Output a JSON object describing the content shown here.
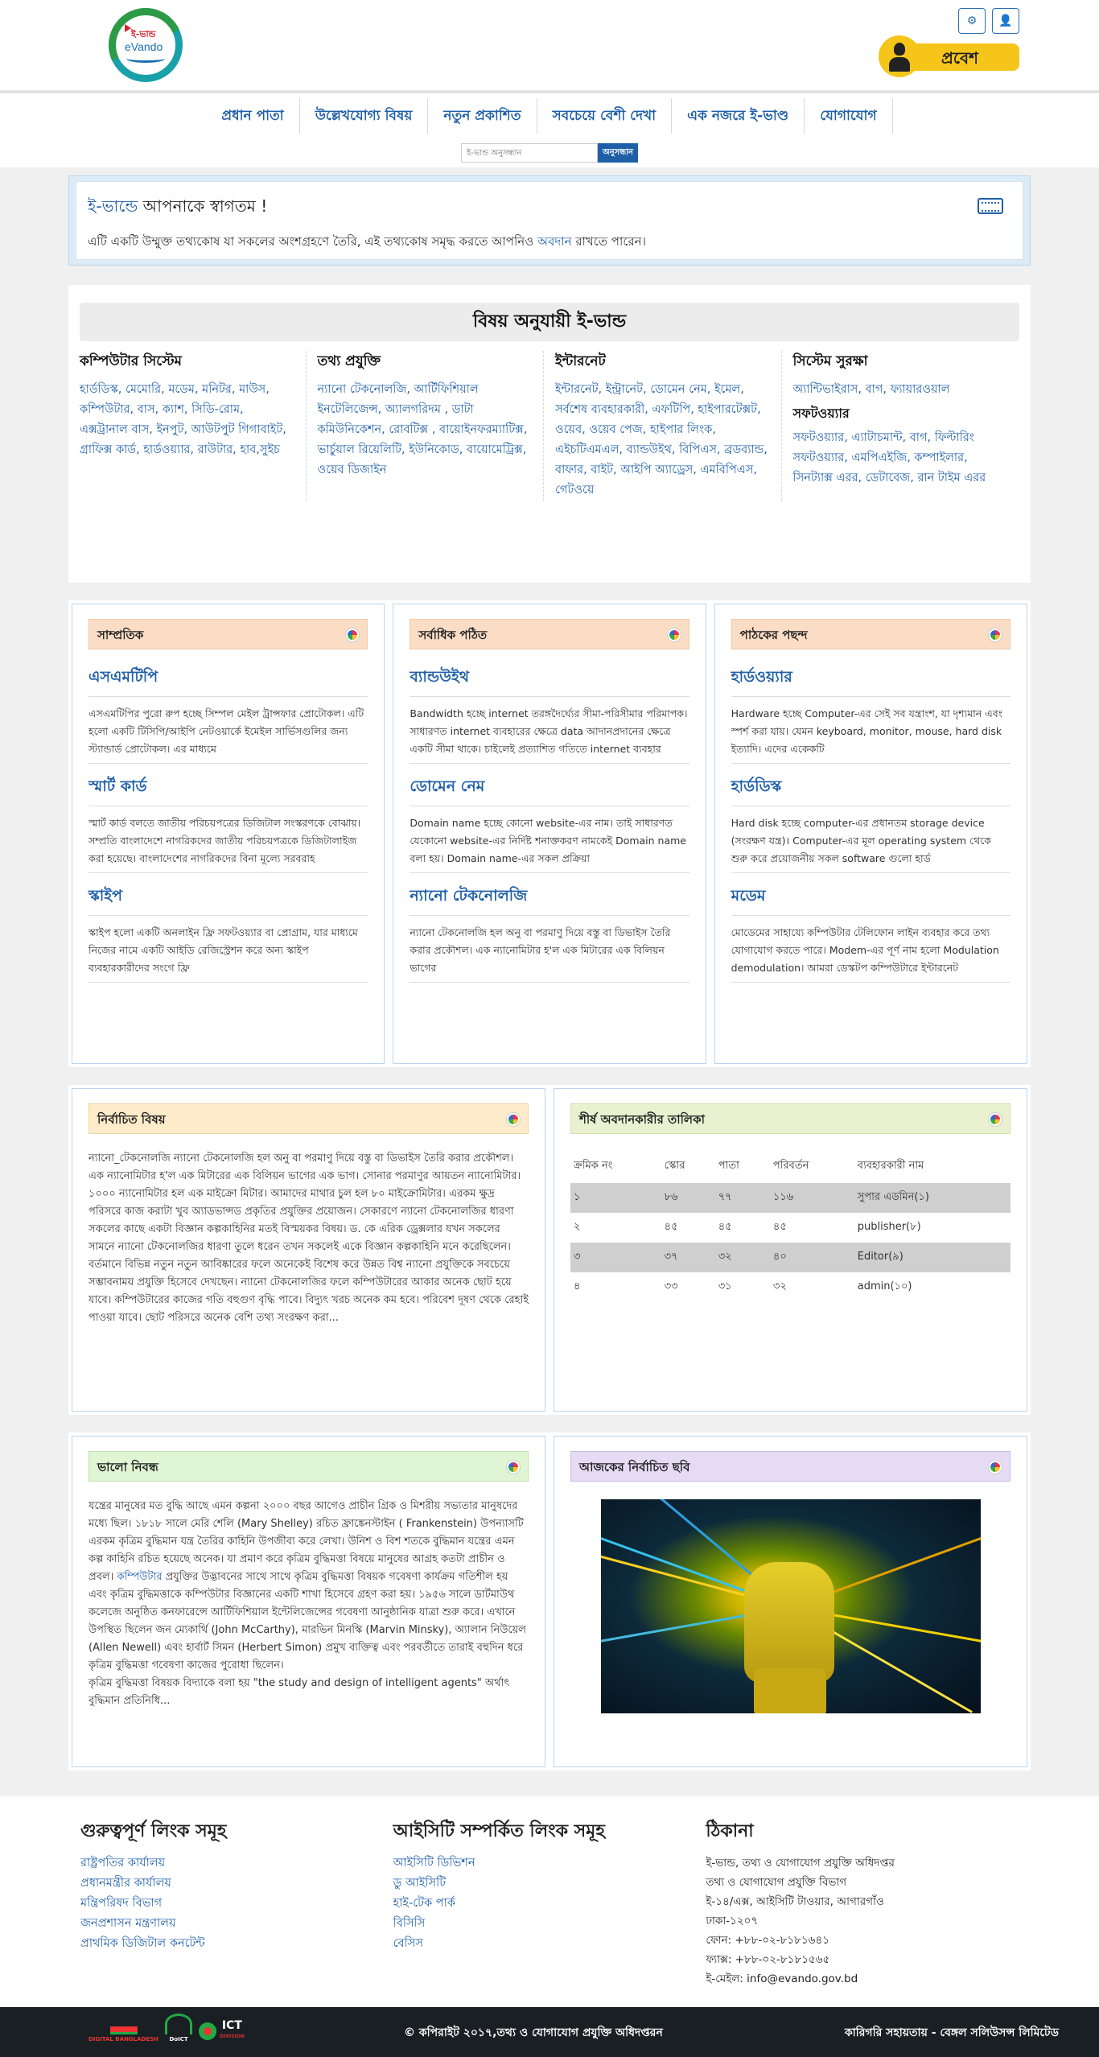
{
  "header": {
    "logo_text_top": "ই-ভান্ড",
    "logo_text": "eVando",
    "login_label": "প্রবেশ"
  },
  "nav": {
    "items": [
      "প্রধান পাতা",
      "উল্লেখযোগ্য বিষয়",
      "নতুন প্রকাশিত",
      "সবচেয়ে বেশী দেখা",
      "এক নজরে ই-ভাণ্ড",
      "যোগাযোগ"
    ],
    "search_placeholder": "ই-ভান্ড অনুসন্ধান",
    "search_button": "অনুসন্ধান"
  },
  "welcome": {
    "title_highlight": "ই-ভান্ডে",
    "title_rest": " আপনাকে স্বাগতম !",
    "text_before": "এটি একটি উম্মুক্ত তথ্যকোষ যা সকলের অংশগ্রহণে তৈরি, এই তথ্যকোষ সমৃদ্ধ করতে আপনিও ",
    "text_link": "অবদান",
    "text_after": " রাখতে পারেন।"
  },
  "subjects": {
    "title": "বিষয় অনুযায়ী ই-ভান্ড",
    "columns": [
      {
        "heading": "কম্পিউটার সিস্টেম",
        "links": "হার্ডডিস্ক, মেমোরি, মডেম, মনিটর, মাউস, কম্পিউটার, বাস, ক্যাশ, সিডি-রোম, এক্সট্রানাল বাস, ইনপুট, আউটপুট গিগাবাইট, গ্রাফিক্স কার্ড, হার্ডওয়্যার, রাউটার, হাব,সুইচ",
        "heading2": "",
        "links2": ""
      },
      {
        "heading": "তথ্য প্রযুক্তি",
        "links": "ন্যানো টেকনোলজি, আর্টিফিশিয়াল ইনটেলিজেন্স, অ্যালগরিদম , ডাটা কমিউনিকেশন, রোবটিক্স , বায়োইনফরম্যাটিক্স, ভার্চুয়াল রিয়েলিটি, ইউনিকোড, বায়োমেট্রিক্স, ওয়েব ডিজাইন",
        "heading2": "",
        "links2": ""
      },
      {
        "heading": "ইন্টারনেট",
        "links": "ইন্টারনেট, ইন্ট্রানেট, ডোমেন নেম, ইমেল, সর্বশেষ ব্যবহারকারী, এফটিপি, হাইপারটেক্সট, ওয়েব, ওয়েব পেজ, হাইপার লিংক, এইচটিএমএল, ব্যান্ডউইথ, বিপিএস, ব্রডব্যান্ড, বাফার, বাইট, আইপি অ্যাড্রেস, এমবিপিএস, গেটওয়ে",
        "heading2": "",
        "links2": ""
      },
      {
        "heading": "সিস্টেম সুরক্ষা",
        "links": "অ্যান্টিভাইরাস, বাগ, ফ্যায়ারওয়াল",
        "heading2": "সফটওয়্যার",
        "links2": "সফটওয়্যার, এ্যাটাচমান্ট, বাগ, ফিল্টারিং সফটওয়্যার, এমপিএইজি, কম্পাইলার, সিনট্যাক্স এরর, ডেটাবেজ, রান টাইম এরর"
      }
    ]
  },
  "panels_row1": [
    {
      "title": "সাম্প্রতিক",
      "articles": [
        {
          "title": "এসএমটিপি",
          "text": "এসএমটিপির পুরো রুপ হচ্ছে সিম্পল মেইল ট্রান্সফার প্রোটোকল। এটি হলো একটি টিসিপি/আইপি নেটওয়ার্কে ইমেইল সার্ভিসগুলির জন্য স্ট্যান্ডার্ড প্রোটোকল। এর মাধ্যমে"
        },
        {
          "title": "স্মার্ট কার্ড",
          "text": "স্মার্ট কার্ড বলতে জাতীয় পরিচয়পত্রের ডিজিটাল সংস্করণকে বোঝায়। সম্প্রতি বাংলাদেশে নাগরিকদের জাতীয় পরিচয়পত্রকে ডিজিটালাইজ করা হয়েছে। বাংলাদেশের নাগরিকদের বিনা মূল্যে সরবরাহ"
        },
        {
          "title": "স্কাইপ",
          "text": "স্কাইপ হলো একটি অনলাইন ফ্রি সফটওয়্যার বা প্রোগ্রাম, যার মাধ্যমে নিজের নামে একটি আইডি রেজিস্ট্রেশন করে অন্য স্কাইপ ব্যবহারকারীদের সংগে ফ্রি"
        }
      ]
    },
    {
      "title": "সর্বাধিক পঠিত",
      "articles": [
        {
          "title": "ব্যান্ডউইথ",
          "text": "Bandwidth হচ্ছে internet তরঙ্গদৈর্ঘ্যের সীমা-পরিসীমার পরিমাপক। সাধারণত internet ব্যবহারের ক্ষেত্রে data আদানপ্রদানের ক্ষেত্রে একটি সীমা থাকে। চাইলেই প্রত্যাশিত গতিতে internet ব্যবহার"
        },
        {
          "title": "ডোমেন নেম",
          "text": "Domain name হচ্ছে কোনো website-এর নাম। তাই সাধারণত যেকোনো website-এর নির্দিষ্ট শনাক্তকরণ নামকেই Domain name বলা হয়। Domain name-এর সকল প্রক্রিয়া"
        },
        {
          "title": "ন্যানো টেকনোলজি",
          "text": "ন্যানো টেকনোলজি হল অনু বা পরমাণু দিয়ে বস্তু বা ডিভাইস তৈরি করার প্রকৌশল। এক ন্যানোমিটার হ'ল এক মিটারের এক বিলিয়ন ভাগের"
        }
      ]
    },
    {
      "title": "পাঠকের পছন্দ",
      "articles": [
        {
          "title": "হার্ডওয়্যার",
          "text": "Hardware হচ্ছে Computer-এর সেই সব যন্ত্রাংশ, যা দৃশ্যমান এবং স্পর্শ করা যায়। যেমন keyboard, monitor, mouse, hard disk ইত্যাদি। এদের একেকটি"
        },
        {
          "title": "হার্ডডিস্ক",
          "text": "Hard disk হচ্ছে computer-এর প্রধানতম storage device (সংরক্ষণ যন্ত্র)। Computer-এর মূল operating system থেকে শুরু করে প্রয়োজনীয় সকল software গুলো হার্ড"
        },
        {
          "title": "মডেম",
          "text": "মোডেমের সাহায্যে কম্পিউটার টেলিফোন লাইন ব্যবহার করে তথ্য যোগাযোগ করতে পারে। Modem-এর পূর্ণ নাম হলো Modulation demodulation। আমরা ডেস্কটপ কম্পিউটারে ইন্টারনেট"
        }
      ]
    }
  ],
  "featured": {
    "title": "নির্বাচিত বিষয়",
    "text": "ন্যানো_টেকনোলজি ন্যানো টেকনোলজি হল অনু বা পরমাণু দিয়ে বস্তু বা ডিভাইস তৈরি করার প্রকৌশল। এক ন্যানোমিটার হ'ল এক মিটারের এক বিলিয়ন ভাগের এক ভাগ। সোনার পরমাণুর আয়তন ন্যানোমিটার। ১০০০ ন্যানোমিটার হল এক মাইক্রো মিটার। আমাদের মাথার চুল হল ৮০ মাইক্রোমিটার। এরকম ক্ষুদ্র পরিসরে কাজ করাটা খুব অ্যাডভান্সড প্রকৃতির প্রযুক্তির প্রয়োজন। সেকারণে ন্যানো টেকনোলজির ধারণা সকলের কাছে একটা বিজ্ঞান কল্পকাহিনির মতই বিস্ময়কর বিষয়। ড. কে এরিক ড্রেক্সলার যখন সকলের সামনে ন্যানো টেকনোলজির ধারণা তুলে ধরেন তখন সকলেই একে বিজ্ঞান কল্পকাহিনি মনে করেছিলেন। বর্তমানে বিভিন্ন নতুন নতুন আবিষ্কারের ফলে অনেকেই বিশেষ করে উন্নত বিশ্ব ন্যানো প্রযুক্তিকে সবচেয়ে সম্ভাবনাময় প্রযুক্তি হিসেবে দেখছেন। ন্যানো টেকনোলজির ফলে কম্পিউটারের আকার অনেক ছোট হয়ে যাবে। কম্পিউটারের কাজের গতি বহুগুণ বৃদ্ধি পাবে। বিদ্যুৎ খরচ অনেক কম হবে। পরিবেশ দূষণ থেকে রেহাই পাওয়া যাবে। ছোট পরিসরে অনেক বেশি তথ্য সংরক্ষণ করা..."
  },
  "top_donors": {
    "title": "শীর্ষ অবদানকারীর তালিকা",
    "columns": [
      "ক্রমিক নং",
      "স্কোর",
      "পাতা",
      "পরিবর্তন",
      "ব্যবহারকারী নাম"
    ],
    "rows": [
      [
        "১",
        "৮৬",
        "৭৭",
        "১১৬",
        "সুপার এডমিন(১)"
      ],
      [
        "২",
        "৪৫",
        "৪৫",
        "৪৫",
        "publisher(৮)"
      ],
      [
        "৩",
        "৩৭",
        "৩২",
        "৪০",
        "Editor(৯)"
      ],
      [
        "৪",
        "৩৩",
        "৩১",
        "৩২",
        "admin(১০)"
      ]
    ]
  },
  "good_essay": {
    "title": "ভালো নিবন্ধ",
    "text_before": "যন্ত্রের মানুষের মত বুদ্ধি আছে এমন কল্পনা ২০০০ বছর আগেও প্রাচীন গ্রিক ও মিশরীয় সভ্যতার মানুষদের মধ্যে ছিল। ১৮১৮ সালে মেরি শেলি (Mary Shelley) রচিত ফ্রাঙ্কেনস্টাইন ( Frankenstein) উপন্যাসটি এরকম কৃত্রিম বুদ্ধিমান যন্ত্র তৈরির কাহিনি উপজীব্য করে লেখা। উনিশ ও বিশ শতকে বুদ্ধিমান যন্ত্রের এমন কল্প কাহিনি রচিত হয়েছে অনেক। যা প্রমাণ করে কৃত্রিম বুদ্ধিমত্তা বিষয়ে মানুষের আগ্রহ কতটা প্রাচীন ও প্রবল। ",
    "text_link": "কম্পিউটার",
    "text_after": " প্রযুক্তির উদ্ভাবনের সাথে সাথে কৃত্রিম বুদ্ধিমত্তা বিষয়ক গবেষণা কার্যক্রম গতিশীল হয় এবং কৃত্রিম বুদ্ধিমত্তাকে কম্পিউটার বিজ্ঞানের একটি শাখা হিসেবে গ্রহণ করা হয়। ১৯৫৬ সালে ডার্টমাউথ কলেজে অনুষ্ঠিত কনফারেন্সে আর্টিফিশিয়াল ইন্টেলিজেন্সের গবেষণা আনুষ্ঠানিক যাত্রা শুরু করে। এখানে উপস্থিত ছিলেন জন ম্যেকার্থি (John McCarthy), মারভিন মিনস্কি (Marvin Minsky), অ্যালান নিউয়েল (Allen Newell) এবং হার্বার্ট সিমন (Herbert Simon) প্রমুখ ব্যক্তিত্ব এবং পরবর্তীতে তারাই বহুদিন ধরে কৃত্রিম বুদ্ধিমত্তা গবেষণা কাজের পুরোধা ছিলেন।",
    "text2": "কৃত্রিম বুদ্ধিমত্তা বিষয়ক বিদ্যাকে বলা হয় \"the study and design of intelligent agents\" অর্থাৎ বুদ্ধিমান প্রতিনিধি..."
  },
  "picture_of_day": {
    "title": "আজকের নির্বাচিত ছবি"
  },
  "footer": {
    "col1": {
      "heading": "গুরুত্বপূর্ণ লিংক সমূহ",
      "links": [
        "রাষ্ট্রপতির কার্যালয়",
        "প্রধানমন্ত্রীর কার্যালয়",
        "মন্ত্রিপরিষদ বিভাগ",
        "জনপ্রশাসন মন্ত্রণালয়",
        "প্রাথমিক ডিজিটাল কনটেন্ট"
      ]
    },
    "col2": {
      "heading": "আইসিটি সম্পর্কিত লিংক সমূহ",
      "links": [
        "আইসিটি ডিভিশন",
        "ডু আইসিটি",
        "হাই-টেক পার্ক",
        "বিসিসি",
        "বেসিস"
      ]
    },
    "col3": {
      "heading": "ঠিকানা",
      "lines": [
        "ই-ভান্ড, তথ্য ও যোগাযোগ প্রযুক্তি অধিদপ্তর",
        "তথ্য ও যোগাযোগ প্রযুক্তি বিভাগ",
        "ই-১৪/এক্স, আইসিটি টাওয়ার, আগারগাঁও",
        "ঢাকা-১২০৭",
        "ফোন: +৮৮-০২-৮১৮১৬৪১",
        "ফ্যাক্স: +৮৮-০২-৮১৮১৫৬৫",
        "ই-মেইল: info@evando.gov.bd"
      ]
    },
    "copyright": "© কপিরাইট ২০১৭,তথ্য ও যোগাযোগ প্রযুক্তি অধিদপ্তরন",
    "credit": "কারিগরি সহায়তায় - বেঙ্গল সলিউসন্স লিমিটেড",
    "logo1_text": "DIGITAL BANGLADESH",
    "logo2_text": "DoICT",
    "logo3_text": "ICT",
    "logo3_sub": "DIVISION"
  }
}
